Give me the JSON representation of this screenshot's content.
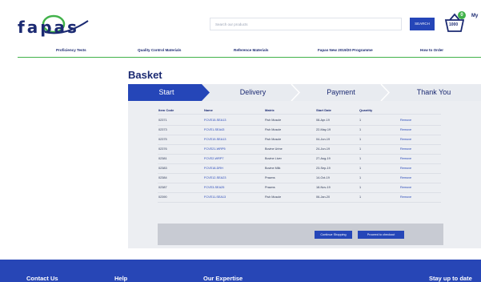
{
  "header": {
    "logo_text": "fapas",
    "search_placeholder": "Search our products",
    "search_button": "SEARCH",
    "basket_badge": "0",
    "basket_count": "1000",
    "account_label": "My"
  },
  "nav": {
    "items": [
      "Proficiency Tests",
      "Quality Control Materials",
      "Reference Materials",
      "Fapas New 2019/20 Programme",
      "How to Order"
    ]
  },
  "page": {
    "title": "Basket"
  },
  "steps": [
    "Start",
    "Delivery",
    "Payment",
    "Thank You"
  ],
  "table": {
    "headers": [
      "Item Code",
      "Name",
      "Matrix",
      "Start Date",
      "Quantity"
    ],
    "remove_label": "Remove",
    "rows": [
      [
        "02371",
        "FCVE15-SEA13",
        "Fish Muscle",
        "08-Apr-19",
        "1"
      ],
      [
        "02373",
        "FCVE1-SEA43",
        "Fish Muscle",
        "22-May-19",
        "1"
      ],
      [
        "02375",
        "FCVE19-SEA13",
        "Fish Muscle",
        "04-Jun-19",
        "1"
      ],
      [
        "02376",
        "FCVE21-WRP5",
        "Bovine Urine",
        "24-Jun-19",
        "1"
      ],
      [
        "02381",
        "FCVE2-WRP7",
        "Bovine Liver",
        "27-Aug-19",
        "1"
      ],
      [
        "02383",
        "FCVE18-DRH",
        "Bovine Milk",
        "23-Sep-19",
        "1"
      ],
      [
        "02384",
        "FCVE12-SEA23",
        "Prawns",
        "14-Oct-19",
        "1"
      ],
      [
        "02387",
        "FCVE3-SEA25",
        "Prawns",
        "18-Nov-19",
        "1"
      ],
      [
        "02390",
        "FCVE11-SEA13",
        "Fish Muscle",
        "06-Jan-20",
        "1"
      ]
    ]
  },
  "actions": {
    "continue": "Continue Shopping",
    "checkout": "Proceed to checkout"
  },
  "footer": {
    "items": [
      "Contact Us",
      "Help",
      "Our Expertise",
      "Stay up to date"
    ]
  },
  "colors": {
    "brand_blue": "#2546b8",
    "navy": "#1b2a72",
    "accent_green": "#41b24a",
    "footer_blue": "#2746b6"
  }
}
